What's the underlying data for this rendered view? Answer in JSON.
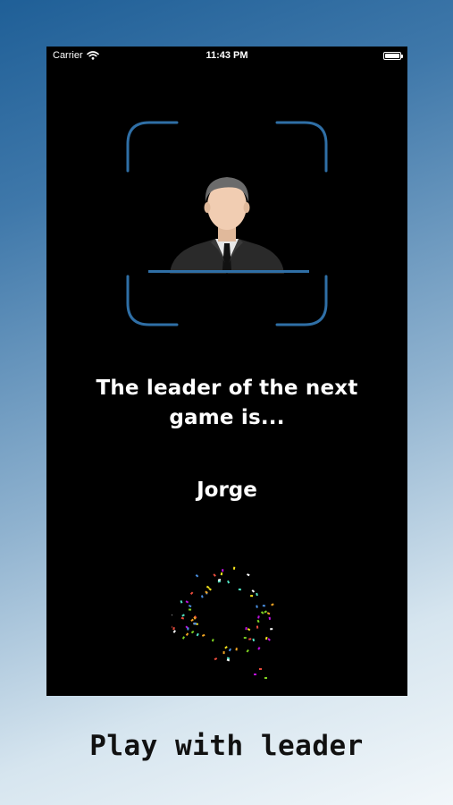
{
  "status_bar": {
    "carrier": "Carrier",
    "time": "11:43 PM"
  },
  "main": {
    "message": "The leader of the next game is...",
    "leader_name": "Jorge"
  },
  "caption": "Play with leader",
  "colors": {
    "frame_accent": "#2f6fa6",
    "background_top": "#1f5f97",
    "background_bottom": "#f2f7fa",
    "confetti": [
      "#e94b3c",
      "#f5a623",
      "#f8e71c",
      "#7ed321",
      "#4a90e2",
      "#50e3c2",
      "#bd10e0",
      "#ffffff"
    ]
  },
  "icons": [
    "wifi-icon",
    "battery-icon",
    "scan-frame-icon",
    "leader-avatar-icon",
    "confetti-animation"
  ]
}
